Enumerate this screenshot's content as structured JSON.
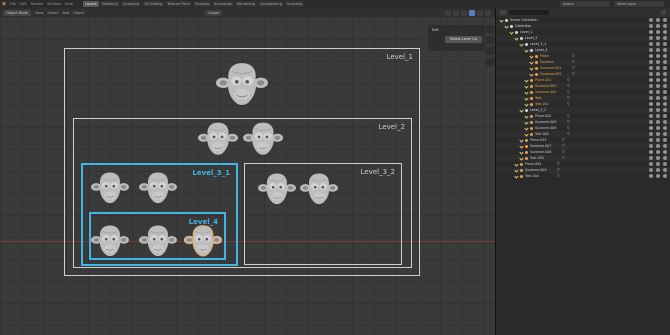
{
  "app": {
    "logo": "blender-logo"
  },
  "menu": [
    "File",
    "Edit",
    "Render",
    "Window",
    "Help"
  ],
  "workspace_tabs": [
    {
      "label": "Layout",
      "active": true
    },
    {
      "label": "Modeling",
      "active": false
    },
    {
      "label": "Sculpting",
      "active": false
    },
    {
      "label": "UV Editing",
      "active": false
    },
    {
      "label": "Texture Paint",
      "active": false
    },
    {
      "label": "Shading",
      "active": false
    },
    {
      "label": "Animation",
      "active": false
    },
    {
      "label": "Rendering",
      "active": false
    },
    {
      "label": "Compositing",
      "active": false
    },
    {
      "label": "Scripting",
      "active": false
    }
  ],
  "scene": {
    "label": "Scene"
  },
  "view_layer": {
    "label": "View Layer"
  },
  "viewport_header": {
    "mode": "Object Mode",
    "menus": [
      "View",
      "Select",
      "Add",
      "Object"
    ],
    "orientation": "Global"
  },
  "npanel": {
    "title": "Edit",
    "button": "Select Level Up"
  },
  "levels": {
    "level1": "Level_1",
    "level2": "Level_2",
    "level31": "Level_3_1",
    "level32": "Level_3_2",
    "level4": "Level_4"
  },
  "outliner": {
    "rows": [
      {
        "name": "Scene Collection",
        "indent": 0,
        "kind": "coll"
      },
      {
        "name": "Collection",
        "indent": 1,
        "kind": "coll"
      },
      {
        "name": "Level_1",
        "indent": 2,
        "kind": "coll"
      },
      {
        "name": "Level_2",
        "indent": 3,
        "kind": "coll"
      },
      {
        "name": "Level_3_1",
        "indent": 4,
        "kind": "coll"
      },
      {
        "name": "Level_4",
        "indent": 5,
        "kind": "coll"
      },
      {
        "name": "Plane",
        "indent": 6,
        "kind": "hi"
      },
      {
        "name": "Suzanne",
        "indent": 6,
        "kind": "hi"
      },
      {
        "name": "Suzanne.001",
        "indent": 6,
        "kind": "hi"
      },
      {
        "name": "Suzanne.002",
        "indent": 6,
        "kind": "hi"
      },
      {
        "name": "Plane.001",
        "indent": 5,
        "kind": "hi"
      },
      {
        "name": "Suzanne.003",
        "indent": 5,
        "kind": "hi"
      },
      {
        "name": "Suzanne.004",
        "indent": 5,
        "kind": "hi"
      },
      {
        "name": "Text",
        "indent": 5,
        "kind": "hi"
      },
      {
        "name": "Text.001",
        "indent": 5,
        "kind": "hi"
      },
      {
        "name": "Level_3_2",
        "indent": 4,
        "kind": "coll"
      },
      {
        "name": "Plane.002",
        "indent": 5,
        "kind": "obj"
      },
      {
        "name": "Suzanne.005",
        "indent": 5,
        "kind": "obj"
      },
      {
        "name": "Suzanne.006",
        "indent": 5,
        "kind": "obj"
      },
      {
        "name": "Text.002",
        "indent": 5,
        "kind": "obj"
      },
      {
        "name": "Plane.003",
        "indent": 4,
        "kind": "obj"
      },
      {
        "name": "Suzanne.007",
        "indent": 4,
        "kind": "obj"
      },
      {
        "name": "Suzanne.008",
        "indent": 4,
        "kind": "obj"
      },
      {
        "name": "Text.003",
        "indent": 4,
        "kind": "obj"
      },
      {
        "name": "Plane.004",
        "indent": 3,
        "kind": "obj"
      },
      {
        "name": "Suzanne.009",
        "indent": 3,
        "kind": "obj"
      },
      {
        "name": "Text.004",
        "indent": 3,
        "kind": "obj"
      }
    ]
  },
  "colors": {
    "selected_outline": "#3fb7e6",
    "active_object": "#e8a240",
    "frame": "#cfcfcf"
  }
}
